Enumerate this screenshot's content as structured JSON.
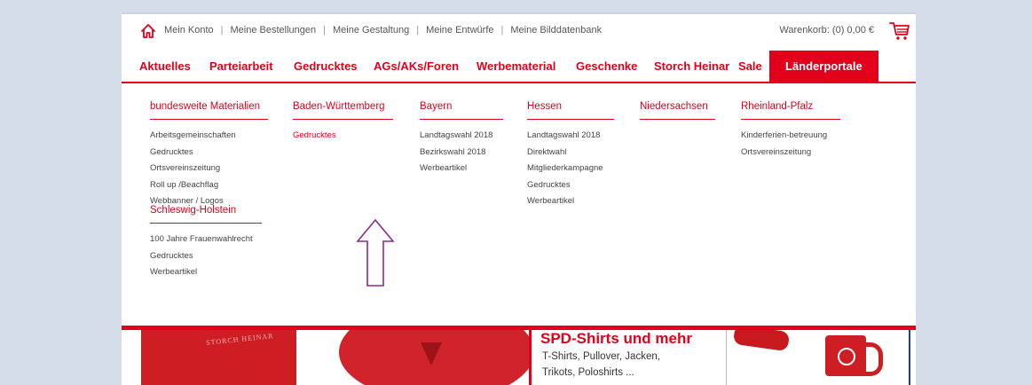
{
  "utility": {
    "links": [
      "Mein Konto",
      "Meine Bestellungen",
      "Meine Gestaltung",
      "Meine Entwürfe",
      "Meine Bilddatenbank"
    ],
    "cart_label": "Warenkorb: (0) 0,00 €"
  },
  "mainnav": {
    "items": [
      "Aktuelles",
      "Parteiarbeit",
      "Gedrucktes",
      "AGs/AKs/Foren",
      "Werbematerial",
      "Geschenke",
      "Storch Heinar",
      "Sale",
      "Länderportale"
    ],
    "active": "Länderportale"
  },
  "dropdown": {
    "columns": [
      {
        "title": "bundesweite Materialien",
        "links": [
          "Arbeitsgemeinschaften",
          "Gedrucktes",
          "Ortsvereinszeitung",
          "Roll up /Beachflag",
          "Webbanner / Logos"
        ]
      },
      {
        "title": "Baden-Württemberg",
        "links": [
          "Gedrucktes"
        ]
      },
      {
        "title": "Bayern",
        "links": [
          "Landtagswahl 2018",
          "Bezirkswahl 2018",
          "Werbeartikel"
        ]
      },
      {
        "title": "Hessen",
        "links": [
          "Landtagswahl 2018",
          "Direktwahl",
          "Mitgliederkampagne",
          "Gedrucktes",
          "Werbeartikel"
        ]
      },
      {
        "title": "Niedersachsen",
        "links": []
      },
      {
        "title": "Rheinland-Pfalz",
        "links": [
          "Kinderferien-betreuung",
          "Ortsvereinszeitung"
        ]
      },
      {
        "title": "Schleswig-Holstein",
        "links": [
          "100 Jahre Frauenwahlrecht",
          "Gedrucktes",
          "Werbeartikel"
        ]
      }
    ]
  },
  "banner": {
    "mug_logo": "STORCH HEINAR",
    "shirt_title": "SPD-Shirts und mehr",
    "shirt_line1": "T-Shirts, Pullover, Jacken,",
    "shirt_line2": "Trikots, Poloshirts ..."
  },
  "colors": {
    "accent": "#e2001a",
    "background": "#d4dde8",
    "arrow": "#8b2a8b"
  }
}
